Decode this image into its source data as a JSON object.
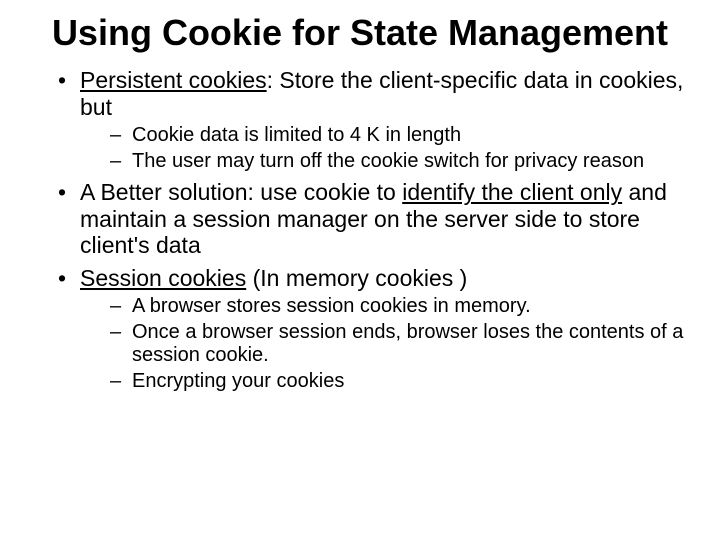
{
  "title": "Using Cookie for State Management",
  "bullets": {
    "b1": {
      "lead": "Persistent cookies",
      "rest": ": Store the client-specific data in cookies, but",
      "sub": [
        "Cookie data is limited to 4 K in length",
        "The user may turn off the cookie switch for privacy reason"
      ]
    },
    "b2": {
      "pre": "A Better solution: use cookie to ",
      "ul": "identify the client only",
      "post": " and maintain a session manager on the server side to store client's data"
    },
    "b3": {
      "lead": "Session cookies",
      "rest": " (In memory cookies )",
      "sub": [
        "A browser stores session cookies in memory.",
        "Once a browser session ends, browser loses the contents of a session cookie.",
        "Encrypting your cookies"
      ]
    }
  }
}
